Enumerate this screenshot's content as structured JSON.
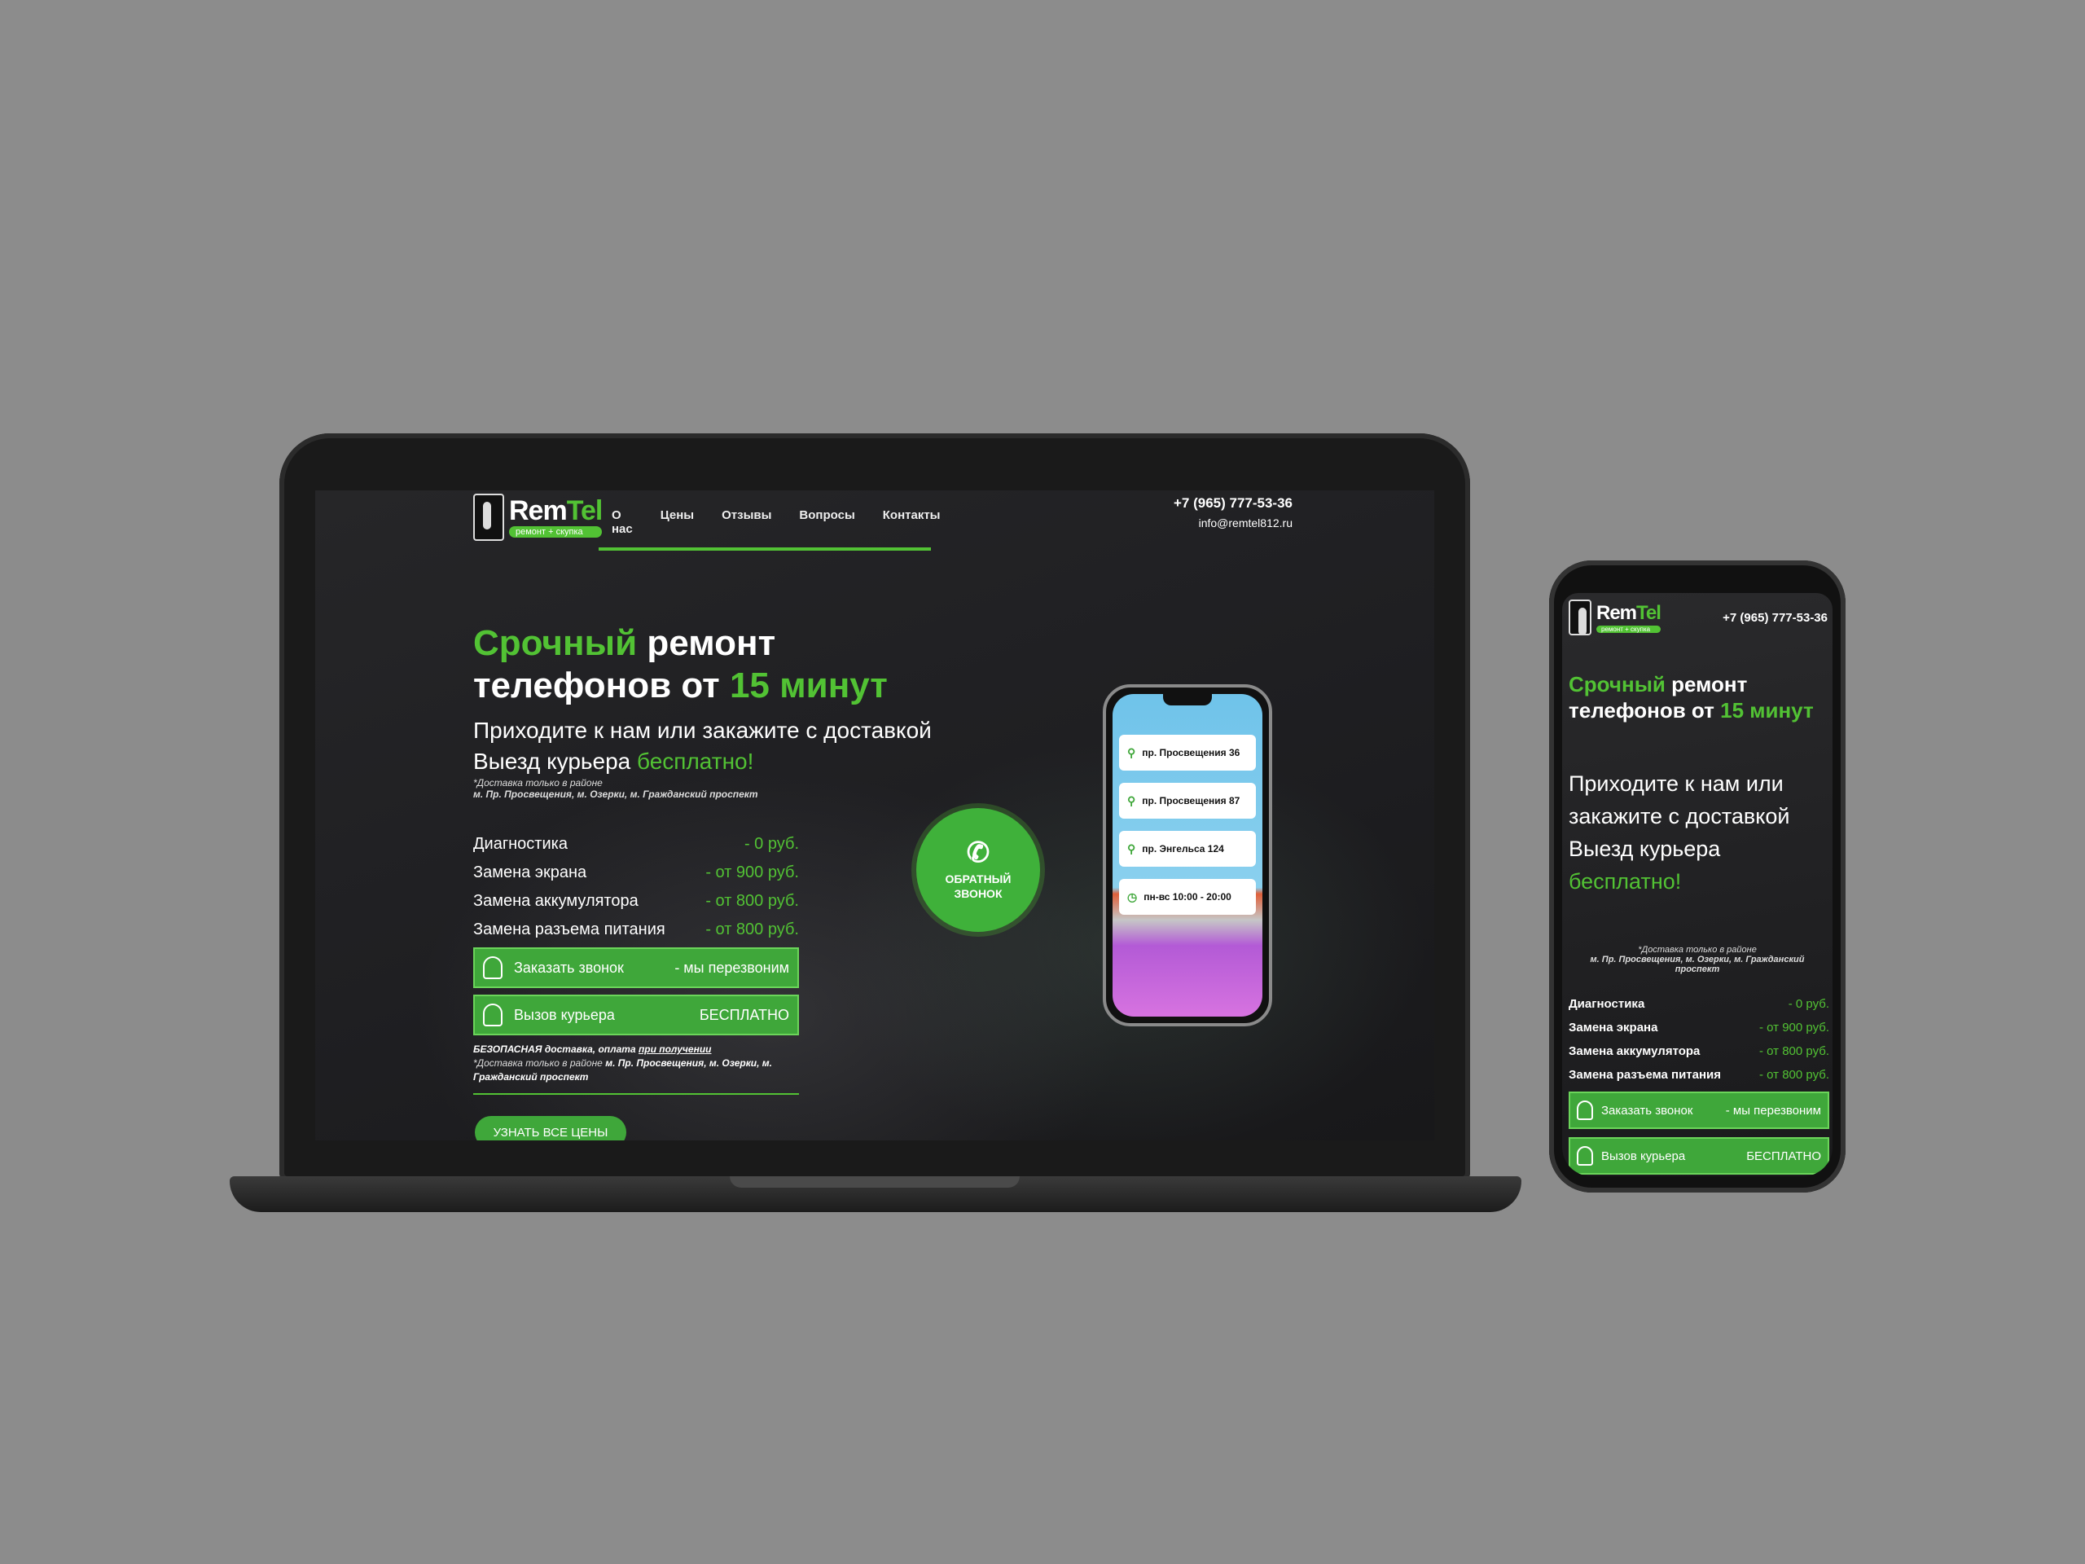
{
  "brand": {
    "name_part1": "Rem",
    "name_part2": "Tel",
    "tagline": "ремонт + скупка"
  },
  "nav": [
    "О нас",
    "Цены",
    "Отзывы",
    "Вопросы",
    "Контакты"
  ],
  "contact": {
    "phone": "+7 (965) 777-53-36",
    "email": "info@remtel812.ru"
  },
  "hero": {
    "title_accent": "Срочный",
    "title_rest1": " ремонт",
    "title_line2": "телефонов от ",
    "title_accent2": "15 минут",
    "sub_line1": "Приходите к нам или закажите с доставкой",
    "sub_line2_prefix": "Выезд курьера ",
    "sub_line2_accent": "бесплатно!",
    "note_top": "*Доставка только в районе",
    "note_areas": "м. Пр. Просвещения, м. Озерки, м. Гражданский проспект"
  },
  "prices": [
    {
      "label": "Диагностика",
      "value": "- 0 руб."
    },
    {
      "label": "Замена экрана",
      "value": "- от 900 руб."
    },
    {
      "label": "Замена аккумулятора",
      "value": "- от 800 руб."
    },
    {
      "label": "Замена разъема питания",
      "value": "- от 800 руб."
    }
  ],
  "buttons": {
    "call_label": "Заказать звонок",
    "call_note": "- мы перезвоним",
    "courier_label": "Вызов курьера",
    "courier_note": "БЕСПЛАТНО",
    "all_prices": "УЗНАТЬ ВСЕ ЦЕНЫ"
  },
  "delivery_note": {
    "safe_prefix": "БЕЗОПАСНАЯ доставка, оплата ",
    "safe_link": "при получении",
    "area_prefix": "*Доставка только в районе ",
    "area_names": "м. Пр. Просвещения, м. Озерки, м. Гражданский проспект"
  },
  "callback": {
    "line1": "ОБРАТНЫЙ",
    "line2": "ЗВОНОК"
  },
  "locations": [
    "пр. Просвещения 36",
    "пр. Просвещения 87",
    "пр. Энгельса 124",
    "пн-вс 10:00 - 20:00"
  ],
  "mobile": {
    "phone": "+7 (965) 777-53-36",
    "sub_line1": "Приходите к нам или",
    "sub_line2": "закажите с доставкой",
    "sub_line3": "Выезд курьера",
    "sub_line4": "бесплатно!",
    "note_top": "*Доставка только в районе",
    "note_areas": "м. Пр. Просвещения, м. Озерки, м. Гражданский проспект"
  },
  "colors": {
    "accent": "#52c234",
    "button": "#3fa73a",
    "background": "#8c8c8c"
  }
}
